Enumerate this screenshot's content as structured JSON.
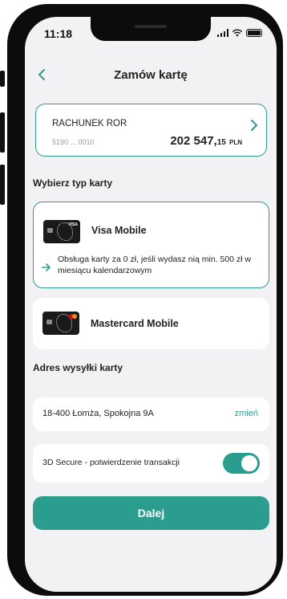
{
  "status_bar": {
    "time": "11:18"
  },
  "header": {
    "back_icon": "chevron-left-icon",
    "title": "Zamów kartę"
  },
  "account": {
    "name": "RACHUNEK ROR",
    "number": "5190 ... 0010",
    "balance_main": "202 547,",
    "balance_cents": "15",
    "currency": "PLN"
  },
  "card_section_label": "Wybierz typ karty",
  "cards": [
    {
      "name": "Visa Mobile",
      "brand": "VISA",
      "info": "Obsługa karty za 0 zł, jeśli wydasz nią min. 500 zł w miesiącu kalendarzowym",
      "selected": true
    },
    {
      "name": "Mastercard Mobile",
      "selected": false
    }
  ],
  "address_section_label": "Adres wysyłki karty",
  "address": {
    "value": "18-400 Łomża, Spokojna 9A",
    "change_label": "zmień"
  },
  "secure": {
    "label": "3D Secure - potwierdzenie transakcji",
    "enabled": true
  },
  "next_button": "Dalej",
  "colors": {
    "accent": "#2a9d8f",
    "background": "#f2f2f4",
    "frame": "#0c0c0c"
  }
}
